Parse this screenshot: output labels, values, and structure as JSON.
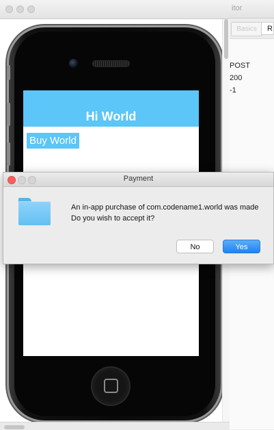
{
  "simulator": {
    "screen_title": "Hi World",
    "buy_button_label": "Buy World"
  },
  "side_panel": {
    "title_fragment": "itor",
    "tab_basics": "Basics",
    "tab_other": "R",
    "lines": [
      "POST",
      "200",
      "-1"
    ]
  },
  "dialog": {
    "title": "Payment",
    "message_line1": "An in-app purchase of com.codename1.world was made",
    "message_line2": "Do you wish to accept it?",
    "no_label": "No",
    "yes_label": "Yes",
    "icon": "folder-icon"
  },
  "colors": {
    "title_bar_blue": "#5bc6f7",
    "yes_button_blue": "#1f82f2",
    "close_red": "#fc605c"
  }
}
